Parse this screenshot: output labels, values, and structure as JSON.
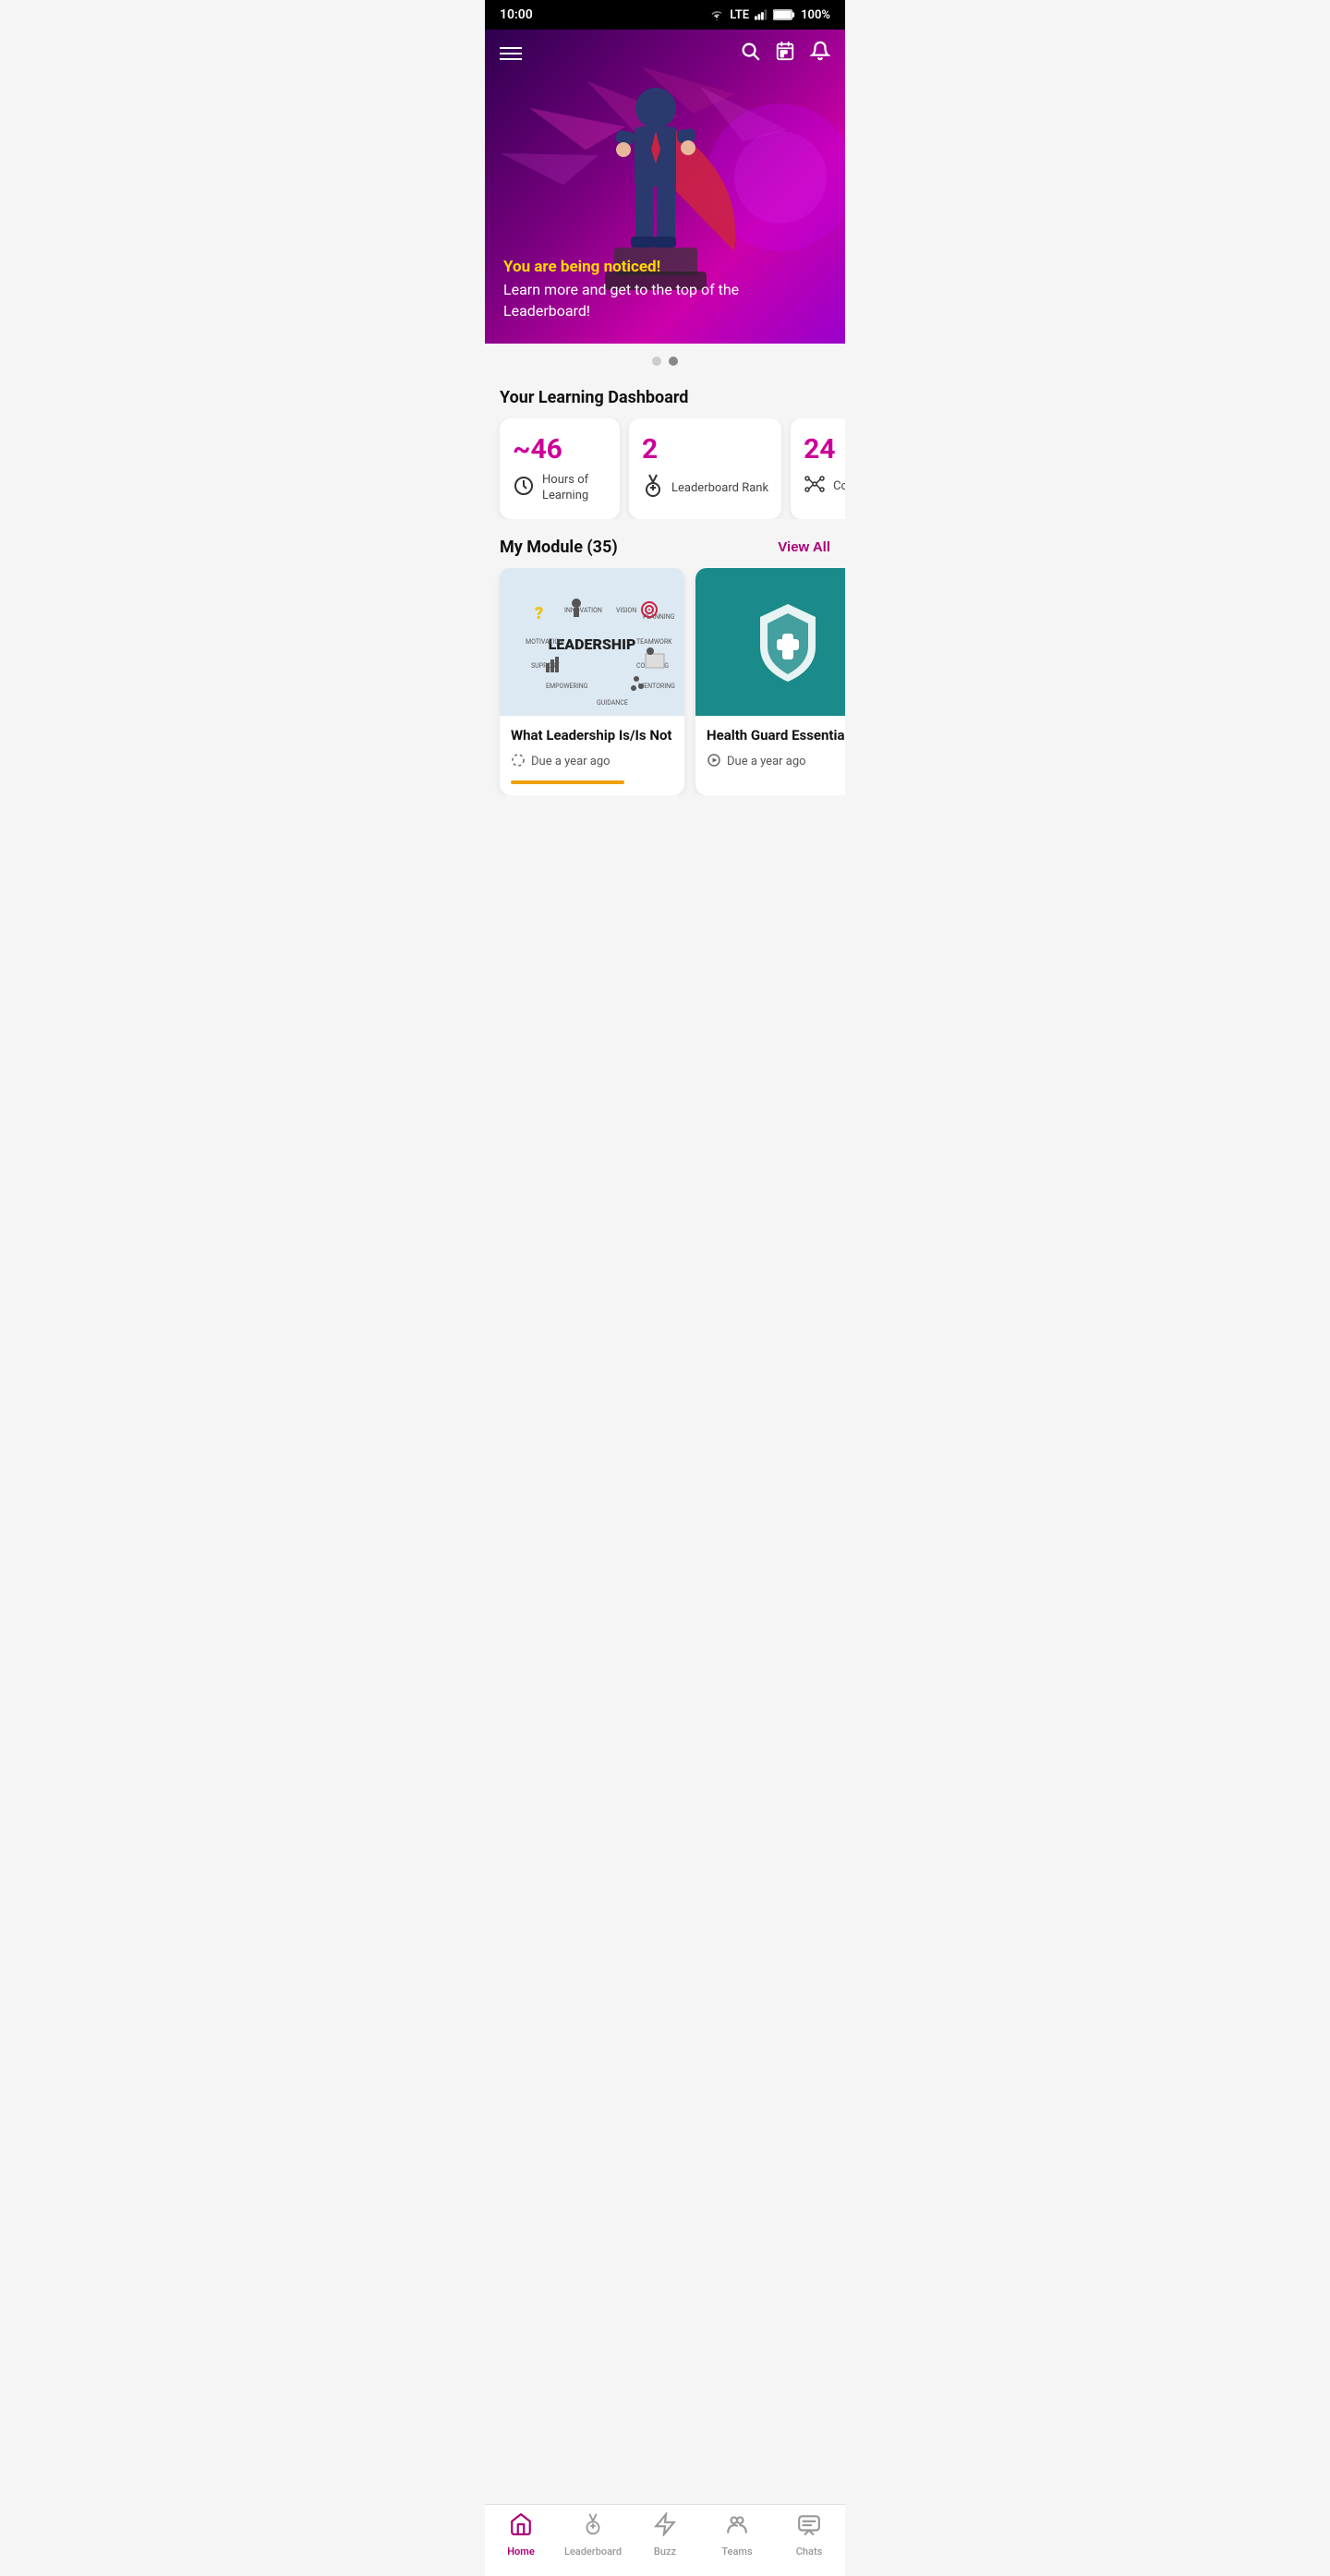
{
  "statusBar": {
    "time": "10:00",
    "signal": "LTE",
    "battery": "100%"
  },
  "hero": {
    "highlightText": "You are being noticed!",
    "subtitleText": "Learn more and get to the top of the Leaderboard!",
    "dots": [
      false,
      true
    ]
  },
  "dashboard": {
    "sectionTitle": "Your Learning Dashboard",
    "stats": [
      {
        "value": "~46",
        "label": "Hours of\nLearning",
        "iconType": "clock"
      },
      {
        "value": "2",
        "label": "Leaderboard Rank",
        "iconType": "medal"
      },
      {
        "value": "24",
        "label": "Courses Enrolled",
        "iconType": "network"
      }
    ]
  },
  "modules": {
    "sectionTitle": "My Module (35)",
    "viewAllLabel": "View All",
    "items": [
      {
        "title": "What Leadership Is/Is Not",
        "dueText": "Due a year ago",
        "iconType": "circle-progress",
        "hasProgress": true
      },
      {
        "title": "Health Guard Essentials",
        "dueText": "Due a year ago",
        "iconType": "play",
        "hasProgress": false
      }
    ]
  },
  "bottomNav": {
    "items": [
      {
        "label": "Home",
        "iconType": "home",
        "active": true
      },
      {
        "label": "Leaderboard",
        "iconType": "medal",
        "active": false
      },
      {
        "label": "Buzz",
        "iconType": "buzz",
        "active": false
      },
      {
        "label": "Teams",
        "iconType": "teams",
        "active": false
      },
      {
        "label": "Chats",
        "iconType": "chats",
        "active": false
      }
    ]
  }
}
